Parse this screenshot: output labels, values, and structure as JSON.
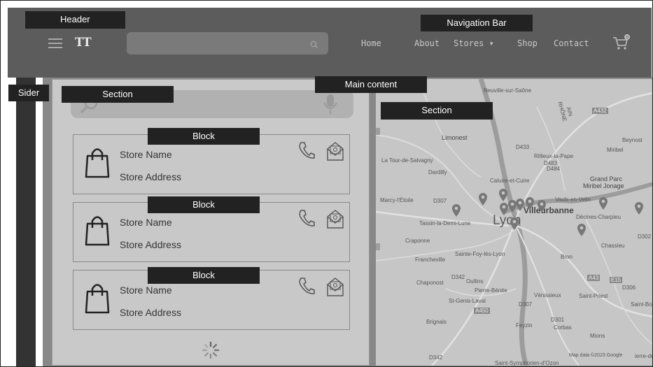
{
  "annotations": {
    "header": "Header",
    "navigation_bar": "Navigation Bar",
    "sider": "Sider",
    "section_left": "Section",
    "main_content": "Main content",
    "section_map": "Section",
    "block": "Block"
  },
  "header": {
    "logo": "TT",
    "search": {
      "placeholder": ""
    },
    "nav": {
      "home": "Home",
      "about": "About",
      "stores": "Stores ▾",
      "shop": "Shop",
      "contact": "Contact"
    },
    "cart_count": "0"
  },
  "stores": [
    {
      "name": "Store Name",
      "address": "Store Address"
    },
    {
      "name": "Store Name",
      "address": "Store Address"
    },
    {
      "name": "Store Name",
      "address": "Store Address"
    }
  ],
  "map": {
    "labels": {
      "neuville": "Neuville-sur-Saône",
      "rhone": "RHÔNE",
      "ain": "AIN",
      "a432": "A432",
      "limonest": "Limonest",
      "beynost": "Beynost",
      "d433": "D433",
      "rillieux": "Rillieux-la-Pape",
      "miribel": "Miribel",
      "d483": "D483",
      "d484": "D484",
      "tour_salvagny": "La Tour-de-Salvagny",
      "dardilly": "Dardilly",
      "grand_parc": "Grand Parc",
      "miribel_jonage": "Miribel Jonage",
      "caluire": "Caluire-et-Cuire",
      "marcy": "Marcy-l'Étoile",
      "d307": "D307",
      "vaulx": "Vaulx-en-Velin",
      "villeurbanne": "Villeurbanne",
      "decines": "Décines-Charpieu",
      "tassin": "Tassin-la-Demi-Lune",
      "lyon": "Lyon",
      "craponne": "Craponne",
      "chassieu": "Chassieu",
      "d302": "D302",
      "sainte_foy": "Sainte-Foy-lès-Lyon",
      "bron": "Bron",
      "francheville": "Francheville",
      "a43": "A43",
      "e15": "E15",
      "d306": "D306",
      "d342": "D342",
      "chaponost": "Chaponost",
      "oullins": "Oullins",
      "pierre_benite": "Pierre-Bénite",
      "venissieux": "Vénissieux",
      "saint_priest": "Saint-Priest",
      "saint_bo": "Saint-Bo",
      "st_genis": "St-Genis-Laval",
      "d307b": "D307",
      "a450": "A450",
      "brignais": "Brignais",
      "feyzin": "Feyzin",
      "d301": "D301",
      "corbas": "Corbas",
      "mions": "Mions",
      "d342b": "D342",
      "map_data": "Map data ©2023 Google",
      "terre": "ierre-de",
      "symphorien": "Saint-Symphorien-d'Ozon"
    }
  }
}
